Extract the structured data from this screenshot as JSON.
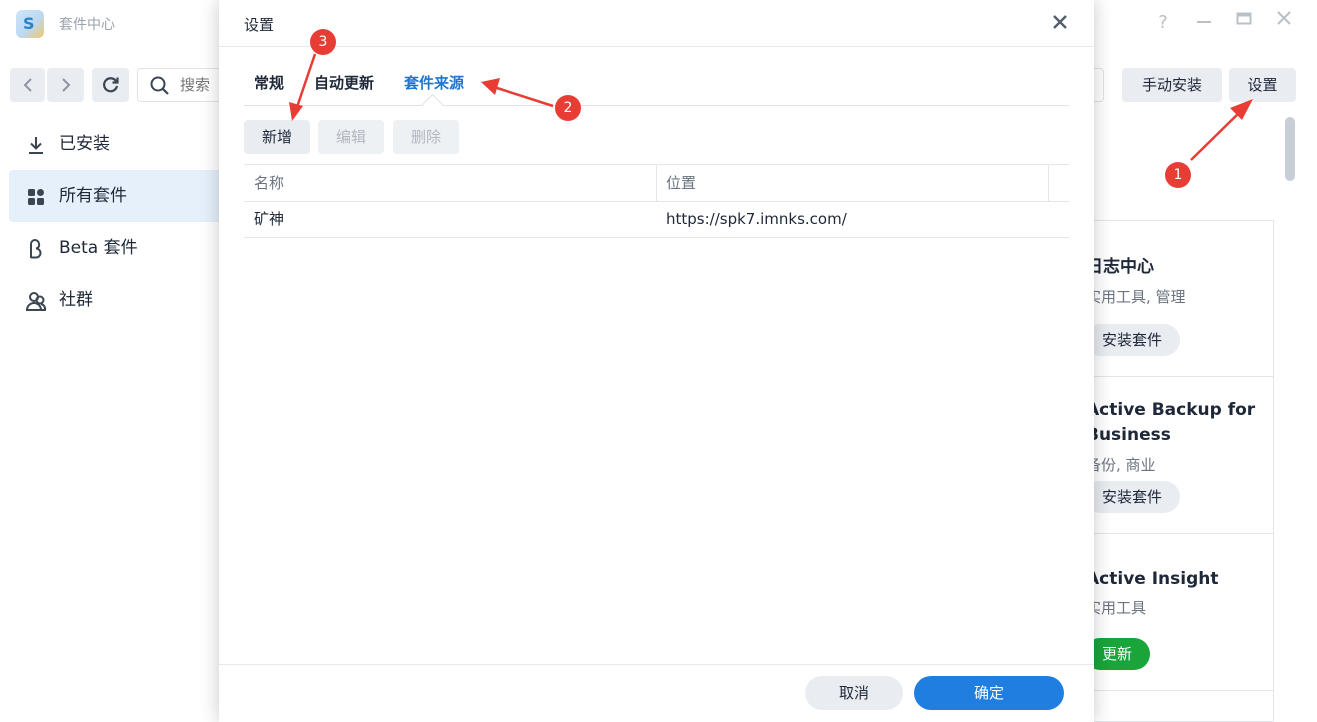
{
  "app": {
    "title": "套件中心",
    "logo_letter": "S",
    "help_glyph": "?",
    "search_placeholder": "搜索",
    "manual_install_label": "手动安装",
    "settings_label": "设置"
  },
  "sidebar": {
    "items": [
      {
        "label": "已安装",
        "icon": "download-icon",
        "active": false
      },
      {
        "label": "所有套件",
        "icon": "grid-icon",
        "active": true
      },
      {
        "label": "Beta 套件",
        "icon": "beta-icon",
        "active": false
      },
      {
        "label": "社群",
        "icon": "community-icon",
        "active": false
      }
    ]
  },
  "cards": [
    {
      "name": "日志中心",
      "category": "实用工具, 管理",
      "action": "安装套件"
    },
    {
      "name": "Active Backup for Business",
      "category": "备份, 商业",
      "action": "安装套件"
    },
    {
      "name": "Active Insight",
      "category": "实用工具",
      "action": "更新"
    }
  ],
  "dialog": {
    "title": "设置",
    "tabs": [
      {
        "label": "常规",
        "active": false
      },
      {
        "label": "自动更新",
        "active": false
      },
      {
        "label": "套件来源",
        "active": true
      }
    ],
    "actions": {
      "add": "新增",
      "edit": "编辑",
      "delete": "删除"
    },
    "columns": {
      "name": "名称",
      "location": "位置"
    },
    "rows": [
      {
        "name": "矿神",
        "location": "https://spk7.imnks.com/"
      }
    ],
    "cancel_label": "取消",
    "ok_label": "确定"
  },
  "annotations": {
    "badge_1": "1",
    "badge_2": "2",
    "badge_3": "3",
    "color": "#e83d35"
  },
  "colors": {
    "accent": "#1f76d2",
    "primary_button": "#1f7ee0",
    "update_button": "#1aa53a"
  }
}
